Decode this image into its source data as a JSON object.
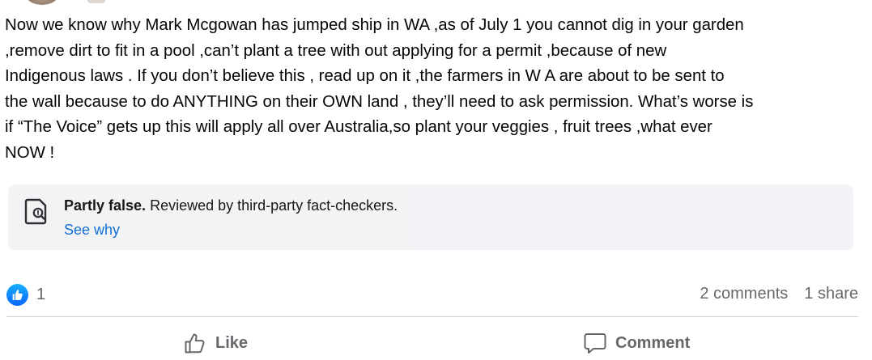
{
  "post": {
    "text": "Now we know why Mark Mcgowan has jumped ship in WA ,as of July 1 you cannot dig in your garden\n,remove dirt to fit in a pool ,can’t plant a tree with out applying for a permit ,because of new\nIndigenous laws . If you don’t believe this , read up on it ,the farmers in W A are about to be sent to\nthe wall because to do ANYTHING on their OWN land , they’ll need to ask permission. What’s worse is\nif “The Voice” gets up this will apply all over Australia,so plant your veggies , fruit trees ,what ever\nNOW !"
  },
  "fact_check": {
    "rating": "Partly false.",
    "description": " Reviewed by third-party fact-checkers.",
    "link_label": "See why",
    "icon": "fact-check-document-icon"
  },
  "stats": {
    "reaction_count": "1",
    "reaction_icon": "like-reaction-icon",
    "comments": "2 comments",
    "shares": "1 share"
  },
  "actions": {
    "like_label": "Like",
    "comment_label": "Comment"
  },
  "colors": {
    "text": "#050505",
    "secondary": "#65676b",
    "link": "#0064d1",
    "box_bg": "#f0f2f5",
    "like_blue": "#0866ff"
  }
}
